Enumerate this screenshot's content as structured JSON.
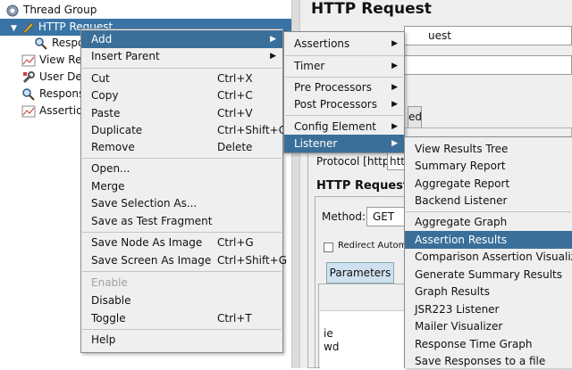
{
  "tree": {
    "items": [
      {
        "label": "Thread Group",
        "icon": "gear-icon"
      },
      {
        "label": "HTTP Request",
        "icon": "pencil-icon"
      },
      {
        "label": "Respo",
        "icon": "magnifier-icon"
      },
      {
        "label": "View Res",
        "icon": "chart-icon"
      },
      {
        "label": "User Def",
        "icon": "wrench-icon"
      },
      {
        "label": "Respons",
        "icon": "magnifier-icon"
      },
      {
        "label": "Assertion",
        "icon": "chart-icon"
      }
    ],
    "expand_arrow": "▼"
  },
  "panel": {
    "title": "HTTP Request",
    "name_value": "uest",
    "tab_label": "ed",
    "protocol_label": "Protocol [http]:",
    "protocol_value": "htt",
    "section_title": "HTTP Request",
    "method_label": "Method:",
    "method_value": "GET",
    "redirect_label": "Redirect Autom",
    "params_tab": "Parameters",
    "rows": [
      "ie",
      "wd"
    ]
  },
  "context_menu": {
    "items": [
      {
        "label": "Add",
        "submenu": true,
        "selected": true
      },
      {
        "label": "Insert Parent",
        "submenu": true
      },
      {
        "label": "Cut",
        "shortcut": "Ctrl+X"
      },
      {
        "label": "Copy",
        "shortcut": "Ctrl+C"
      },
      {
        "label": "Paste",
        "shortcut": "Ctrl+V"
      },
      {
        "label": "Duplicate",
        "shortcut": "Ctrl+Shift+C"
      },
      {
        "label": "Remove",
        "shortcut": "Delete"
      },
      {
        "label": "Open..."
      },
      {
        "label": "Merge"
      },
      {
        "label": "Save Selection As..."
      },
      {
        "label": "Save as Test Fragment"
      },
      {
        "label": "Save Node As Image",
        "shortcut": "Ctrl+G"
      },
      {
        "label": "Save Screen As Image",
        "shortcut": "Ctrl+Shift+G"
      },
      {
        "label": "Enable",
        "disabled": true
      },
      {
        "label": "Disable"
      },
      {
        "label": "Toggle",
        "shortcut": "Ctrl+T"
      },
      {
        "label": "Help"
      }
    ]
  },
  "add_menu": {
    "items": [
      {
        "label": "Assertions"
      },
      {
        "label": "Timer"
      },
      {
        "label": "Pre Processors"
      },
      {
        "label": "Post Processors"
      },
      {
        "label": "Config Element"
      },
      {
        "label": "Listener",
        "selected": true
      }
    ]
  },
  "listener_menu": {
    "items": [
      {
        "label": "View Results Tree"
      },
      {
        "label": "Summary Report"
      },
      {
        "label": "Aggregate Report"
      },
      {
        "label": "Backend Listener"
      },
      {
        "label": "Aggregate Graph"
      },
      {
        "label": "Assertion Results",
        "selected": true
      },
      {
        "label": "Comparison Assertion Visualizer"
      },
      {
        "label": "Generate Summary Results"
      },
      {
        "label": "Graph Results"
      },
      {
        "label": "JSR223 Listener"
      },
      {
        "label": "Mailer Visualizer"
      },
      {
        "label": "Response Time Graph"
      },
      {
        "label": "Save Responses to a file"
      }
    ]
  },
  "colors": {
    "selection": "#3a6f99",
    "tree_selection": "#3a74a6",
    "menu_bg": "#efefef"
  }
}
